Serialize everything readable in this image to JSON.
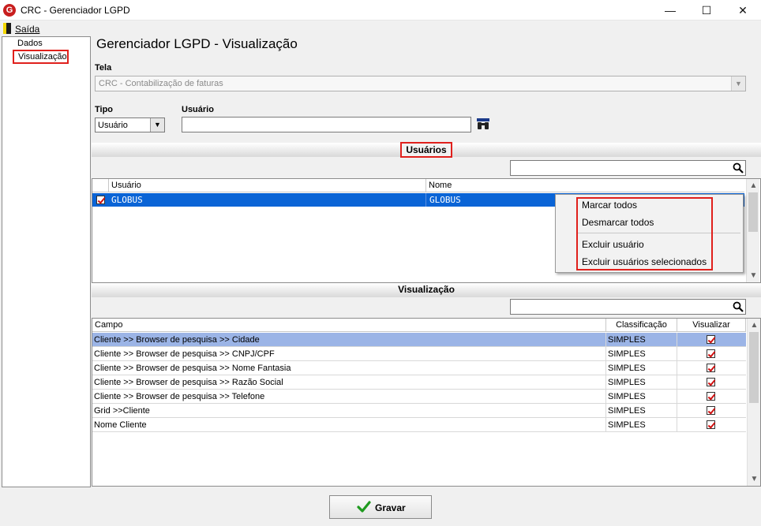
{
  "window": {
    "title": "CRC - Gerenciador LGPD",
    "icon_letter": "G",
    "minimize": "—",
    "maximize": "☐",
    "close": "✕"
  },
  "menu": {
    "saida": "Saída"
  },
  "tree": {
    "items": [
      "Dados",
      "Visualização"
    ]
  },
  "header": {
    "title": "Gerenciador LGPD - Visualização",
    "tela_label": "Tela",
    "tela_value": "CRC - Contabilização de faturas",
    "tipo_label": "Tipo",
    "tipo_value": "Usuário",
    "usuario_label": "Usuário",
    "usuario_value": ""
  },
  "users_section": {
    "title": "Usuários",
    "search_value": "",
    "columns": [
      "Usuário",
      "Nome"
    ],
    "rows": [
      {
        "checked": true,
        "usuario": "GLOBUS",
        "nome": "GLOBUS"
      }
    ]
  },
  "context_menu": {
    "items": [
      "Marcar todos",
      "Desmarcar todos",
      "Excluir usuário",
      "Excluir usuários selecionados"
    ]
  },
  "vis_section": {
    "title": "Visualização",
    "search_value": "",
    "columns": [
      "Campo",
      "Classificação",
      "Visualizar"
    ],
    "rows": [
      {
        "campo": "Cliente >> Browser de pesquisa >> Cidade",
        "classificacao": "SIMPLES",
        "visualizar": true
      },
      {
        "campo": "Cliente >> Browser de pesquisa >> CNPJ/CPF",
        "classificacao": "SIMPLES",
        "visualizar": true
      },
      {
        "campo": "Cliente >> Browser de pesquisa >> Nome Fantasia",
        "classificacao": "SIMPLES",
        "visualizar": true
      },
      {
        "campo": "Cliente >> Browser de pesquisa >> Razão Social",
        "classificacao": "SIMPLES",
        "visualizar": true
      },
      {
        "campo": "Cliente >> Browser de pesquisa >> Telefone",
        "classificacao": "SIMPLES",
        "visualizar": true
      },
      {
        "campo": "Grid >>Cliente",
        "classificacao": "SIMPLES",
        "visualizar": true
      },
      {
        "campo": "Nome Cliente",
        "classificacao": "SIMPLES",
        "visualizar": true
      }
    ]
  },
  "footer": {
    "save_label": "Gravar"
  },
  "colors": {
    "accent_red": "#e0201c",
    "selection_blue": "#0a64d6",
    "row_selected": "#9bb4e6"
  }
}
